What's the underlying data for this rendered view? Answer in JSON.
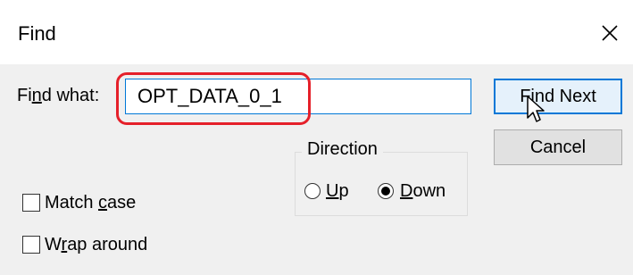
{
  "dialog": {
    "title": "Find",
    "close_icon": "close-icon"
  },
  "find_what": {
    "label_pre": "Fi",
    "label_u": "n",
    "label_post": "d what:",
    "value": "OPT_DATA_0_1"
  },
  "buttons": {
    "find_next_pre": "F",
    "find_next_u": "i",
    "find_next_post": "nd Next",
    "cancel": "Cancel"
  },
  "direction": {
    "legend": "Direction",
    "up_u": "U",
    "up_post": "p",
    "down_u": "D",
    "down_post": "own",
    "selected": "Down"
  },
  "options": {
    "match_case_pre": "Match ",
    "match_case_u": "c",
    "match_case_post": "ase",
    "match_case_checked": false,
    "wrap_pre": "W",
    "wrap_u": "r",
    "wrap_post": "ap around",
    "wrap_checked": false
  },
  "colors": {
    "accent": "#0078d7",
    "highlight": "#e5202a",
    "dialog_bg": "#f0f0f0"
  }
}
